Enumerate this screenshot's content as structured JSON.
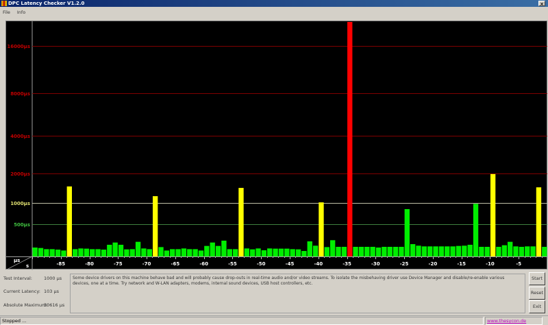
{
  "window": {
    "title": "DPC Latency Checker V1.2.0",
    "close_glyph": "×"
  },
  "menu": {
    "items": [
      "File",
      "Info"
    ]
  },
  "chart_data": {
    "type": "bar",
    "xlabel": "s",
    "ylabel": "µs",
    "x_ticks": [
      -85,
      -80,
      -75,
      -70,
      -65,
      -60,
      -55,
      -50,
      -45,
      -40,
      -35,
      -30,
      -25,
      -20,
      -15,
      -10,
      -5
    ],
    "xlim": [
      -90,
      0
    ],
    "y_ticks": [
      {
        "value": 500,
        "label": "500µs",
        "color": "#40c040",
        "line": "#408040"
      },
      {
        "value": 1000,
        "label": "1000µs",
        "color": "#e0e070",
        "line": "#c0c0a8"
      },
      {
        "value": 2000,
        "label": "2000µs",
        "color": "#c00000",
        "line": "#800000"
      },
      {
        "value": 4000,
        "label": "4000µs",
        "color": "#c00000",
        "line": "#800000"
      },
      {
        "value": 8000,
        "label": "8000µs",
        "color": "#c00000",
        "line": "#800000"
      },
      {
        "value": 16000,
        "label": "16000µs",
        "color": "#c00000",
        "line": "#800000"
      }
    ],
    "values": [
      138,
      131,
      113,
      113,
      106,
      92,
      1560,
      113,
      124,
      121,
      113,
      113,
      106,
      181,
      216,
      181,
      110,
      113,
      227,
      124,
      113,
      1230,
      145,
      92,
      113,
      113,
      124,
      113,
      113,
      92,
      163,
      216,
      163,
      245,
      113,
      113,
      1510,
      124,
      110,
      124,
      96,
      124,
      121,
      121,
      121,
      113,
      110,
      85,
      234,
      167,
      1020,
      145,
      252,
      149,
      149,
      30616,
      149,
      149,
      149,
      149,
      138,
      149,
      149,
      149,
      149,
      855,
      191,
      167,
      156,
      156,
      156,
      156,
      156,
      156,
      163,
      167,
      181,
      980,
      149,
      149,
      1980,
      149,
      174,
      227,
      156,
      149,
      156,
      156,
      1530,
      149
    ],
    "colors": {
      "ok": "#00ee00",
      "warn": "#ffff00",
      "bad": "#ff0000"
    }
  },
  "stats": {
    "test_interval_label": "Test Interval:",
    "test_interval_value": "1000 µs",
    "current_latency_label": "Current Latency:",
    "current_latency_value": "103 µs",
    "absolute_maximum_label": "Absolute Maximum:",
    "absolute_maximum_value": "30616 µs"
  },
  "message": "Some device drivers on this machine behave bad and will probably cause drop-outs in real-time audio and/or video streams. To isolate the misbehaving driver use Device Manager and disable/re-enable various devices, one at a time. Try network and W-LAN adapters, modems, internal sound devices, USB host controllers, etc.",
  "buttons": {
    "start": "Start",
    "reset": "Reset",
    "exit": "Exit"
  },
  "status": {
    "text": "Stopped ...",
    "link": "www.thesycon.de"
  }
}
